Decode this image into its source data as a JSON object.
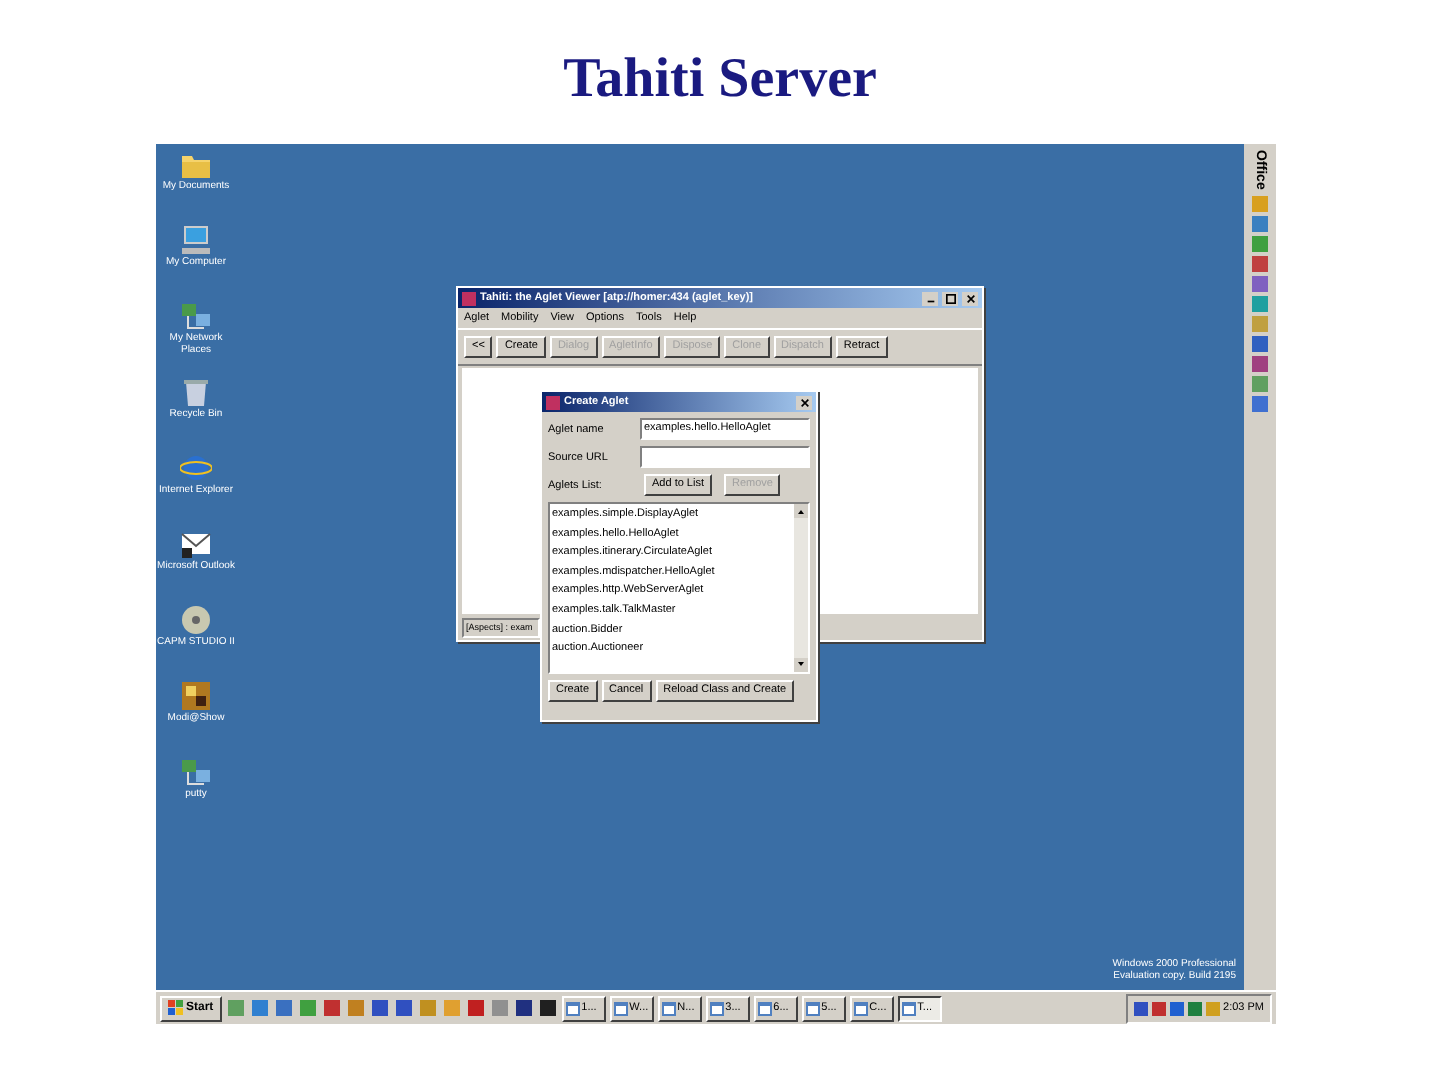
{
  "slide_title": "Tahiti Server",
  "desktop_icons": [
    {
      "label": "My Documents",
      "kind": "folder"
    },
    {
      "label": "My Computer",
      "kind": "computer"
    },
    {
      "label": "My Network Places",
      "kind": "network"
    },
    {
      "label": "Recycle Bin",
      "kind": "bin"
    },
    {
      "label": "Internet Explorer",
      "kind": "browser"
    },
    {
      "label": "Microsoft Outlook",
      "kind": "mail"
    },
    {
      "label": "CAPM STUDIO II",
      "kind": "disc"
    },
    {
      "label": "Modi@Show",
      "kind": "app"
    },
    {
      "label": "putty",
      "kind": "network"
    }
  ],
  "viewer": {
    "title": "Tahiti: the Aglet Viewer [atp://homer:434 (aglet_key)]",
    "menu": [
      "Aglet",
      "Mobility",
      "View",
      "Options",
      "Tools",
      "Help"
    ],
    "toolbar": [
      {
        "label": "<<",
        "disabled": false
      },
      {
        "label": "Create",
        "disabled": false
      },
      {
        "label": "Dialog",
        "disabled": true
      },
      {
        "label": "AgletInfo",
        "disabled": true
      },
      {
        "label": "Dispose",
        "disabled": true
      },
      {
        "label": "Clone",
        "disabled": true
      },
      {
        "label": "Dispatch",
        "disabled": true
      },
      {
        "label": "Retract",
        "disabled": false
      }
    ],
    "status": "[Aspects] : exam"
  },
  "dialog": {
    "title": "Create Aglet",
    "fields": [
      {
        "label": "Aglet name",
        "value": "examples.hello.HelloAglet"
      },
      {
        "label": "Source URL"
      }
    ],
    "list_label": "Aglets List:",
    "list_buttons": [
      {
        "label": "Add to List",
        "disabled": false
      },
      {
        "label": "Remove",
        "disabled": true
      }
    ],
    "list": [
      "examples.simple.DisplayAglet",
      "examples.hello.HelloAglet",
      "examples.itinerary.CirculateAglet",
      "examples.mdispatcher.HelloAglet",
      "examples.http.WebServerAglet",
      "examples.talk.TalkMaster",
      "auction.Bidder",
      "auction.Auctioneer"
    ],
    "buttons": [
      "Create",
      "Cancel",
      "Reload Class and Create"
    ]
  },
  "watermark_lines": [
    "Windows 2000 Professional",
    "Evaluation copy. Build 2195"
  ],
  "office_bar": {
    "label": "Office"
  },
  "taskbar": {
    "start": "Start",
    "tasks": [
      {
        "label": "1...",
        "selected": false
      },
      {
        "label": "W...",
        "selected": false
      },
      {
        "label": "N...",
        "selected": false
      },
      {
        "label": "3...",
        "selected": false
      },
      {
        "label": "6...",
        "selected": false
      },
      {
        "label": "5...",
        "selected": false
      },
      {
        "label": "C...",
        "selected": false
      },
      {
        "label": "T...",
        "selected": true
      }
    ],
    "clock": "2:03 PM"
  }
}
